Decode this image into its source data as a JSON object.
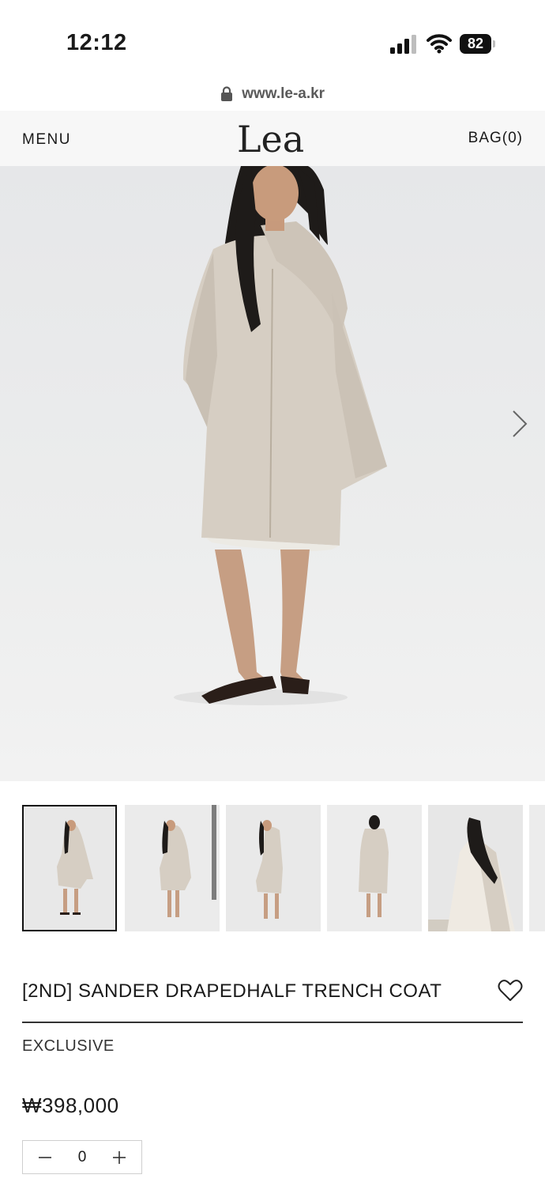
{
  "status_bar": {
    "time": "12:12",
    "battery": "82"
  },
  "browser": {
    "url": "www.le-a.kr"
  },
  "header": {
    "menu_label": "MENU",
    "logo_text": "Lea",
    "bag_label": "BAG(0)"
  },
  "product": {
    "title": "[2ND] SANDER DRAPEDHALF TRENCH COAT",
    "tag": "EXCLUSIVE",
    "price": "₩398,000",
    "quantity": "0"
  },
  "colors": {
    "coat": "#d6cec3",
    "background": "#e8e9ea",
    "text": "#1a1a1a"
  },
  "icons": [
    "lock-icon",
    "signal-icon",
    "wifi-icon",
    "battery-icon",
    "chevron-right-icon",
    "heart-icon",
    "minus-icon",
    "plus-icon"
  ]
}
